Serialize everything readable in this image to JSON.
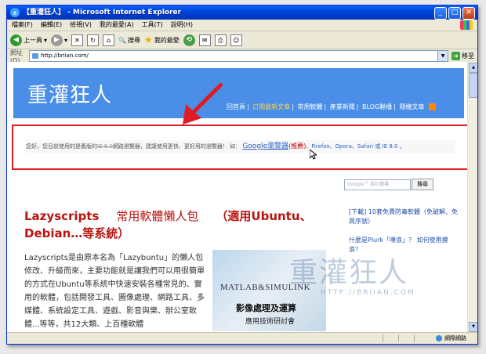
{
  "window": {
    "title": "【重灌狂人】 - Microsoft Internet Explorer"
  },
  "menu": [
    "檔案(F)",
    "編輯(E)",
    "檢視(V)",
    "我的最愛(A)",
    "工具(T)",
    "說明(H)"
  ],
  "toolbar": {
    "back": "上一頁",
    "search": "搜尋",
    "favorites": "我的最愛"
  },
  "address": {
    "label": "網址(D)",
    "url": "http://briian.com/",
    "go": "移至"
  },
  "site": {
    "logo": "重灌狂人",
    "nav": [
      "回首頁",
      "訂閱最新文章",
      "常用軟體",
      "產業新聞",
      "BLOG聯播",
      "隨機文章"
    ]
  },
  "notice": {
    "lead": "您好，您目前使用的是舊版的",
    "old_browser": "IE 6.0",
    "mid": "網路瀏覽器，建議使用更快、更好用的瀏覽器！ 如：",
    "google_browser": "Google瀏覽器",
    "recommend": "(推薦)",
    "others": "、Firefox、Opera、Safari 或 IE 8.0 。"
  },
  "search": {
    "placeholder": "Google™ 自訂搜尋",
    "button": "搜尋"
  },
  "sidebar": {
    "link1": "[下載] 10套免費防毒軟體（免破解、免買序號）",
    "link2": "什麼是Plurk「噗浪」？ 如何使用摸浪？"
  },
  "post": {
    "title_a": "Lazyscripts",
    "title_b": "常用軟體懶人包",
    "title_c": "（適用Ubuntu、Debian…等系統）",
    "body": "Lazyscripts是由原本名為「Lazybuntu」的懶人包修改、升級而來，主要功能就是讓我們可以用很簡單的方式在Ubuntu等系統中快速安裝各種常見的、實用的軟體，包括開發工具、圖像處理、網路工具、多媒體、系統設定工具、遊戲、影音與樂、辦公室軟體...等等，共12大類、上百種軟體"
  },
  "thumbnail": {
    "line1": "MATLAB&SIMULINK",
    "line2": "影像處理及運算",
    "line3": "應用技術研討會"
  },
  "watermark": {
    "line1": "重灌狂人",
    "line2": "HTTP://BRIIAN.COM"
  },
  "status": {
    "zone": "網際網路"
  },
  "colors": {
    "titlebar": "#0044d6",
    "header": "#4a8ee8",
    "highlight_border": "#e01b24",
    "post_title": "#b8140f"
  }
}
